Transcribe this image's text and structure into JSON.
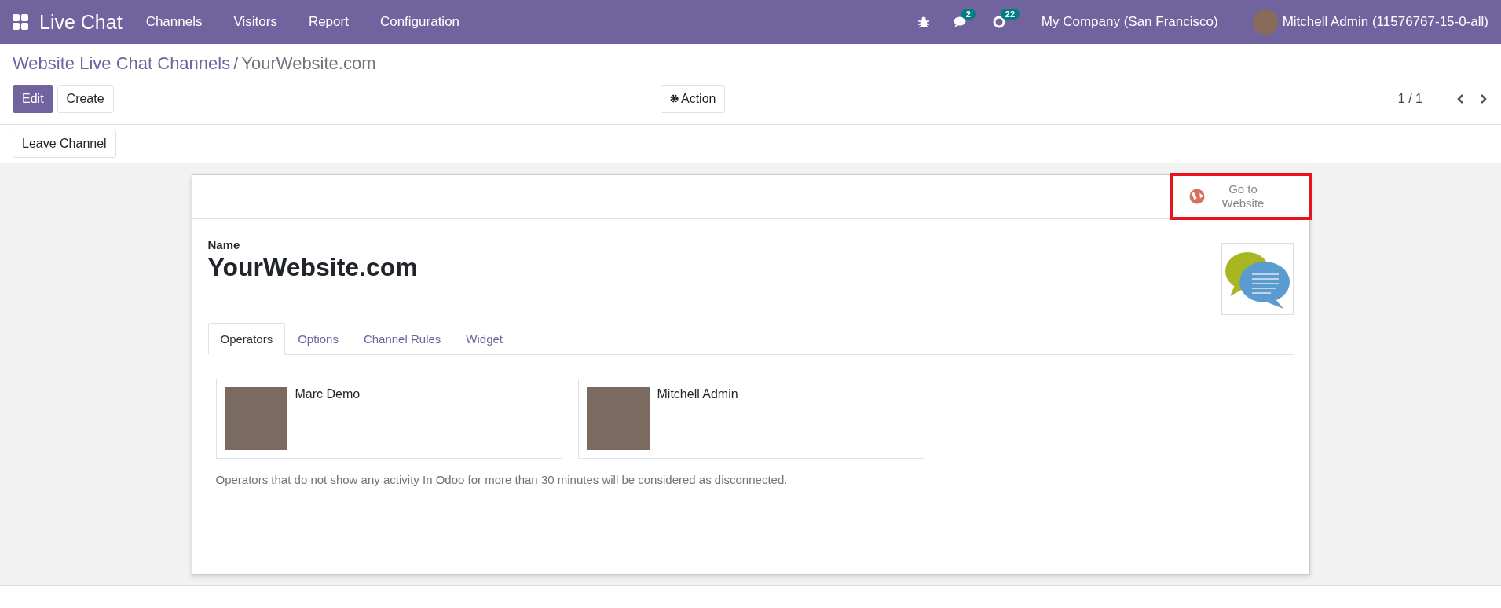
{
  "navbar": {
    "app_title": "Live Chat",
    "menu": [
      "Channels",
      "Visitors",
      "Report",
      "Configuration"
    ],
    "messages_badge": "2",
    "activities_badge": "22",
    "company": "My Company (San Francisco)",
    "user": "Mitchell Admin (11576767-15-0-all)"
  },
  "breadcrumb": {
    "parent": "Website Live Chat Channels",
    "separator": "/",
    "current": "YourWebsite.com"
  },
  "buttons": {
    "edit": "Edit",
    "create": "Create",
    "action": "Action",
    "leave": "Leave Channel"
  },
  "pager": "1 / 1",
  "form": {
    "smart_button": "Go to Website",
    "highlighted": true,
    "name_label": "Name",
    "name": "YourWebsite.com",
    "tabs": [
      {
        "label": "Operators",
        "selected": true
      },
      {
        "label": "Options",
        "selected": false
      },
      {
        "label": "Channel Rules",
        "selected": false
      },
      {
        "label": "Widget",
        "selected": false
      }
    ],
    "operators": [
      {
        "name": "Marc Demo"
      },
      {
        "name": "Mitchell Admin"
      }
    ],
    "note": "Operators that do not show any activity In Odoo for more than 30 minutes will be considered as disconnected."
  }
}
